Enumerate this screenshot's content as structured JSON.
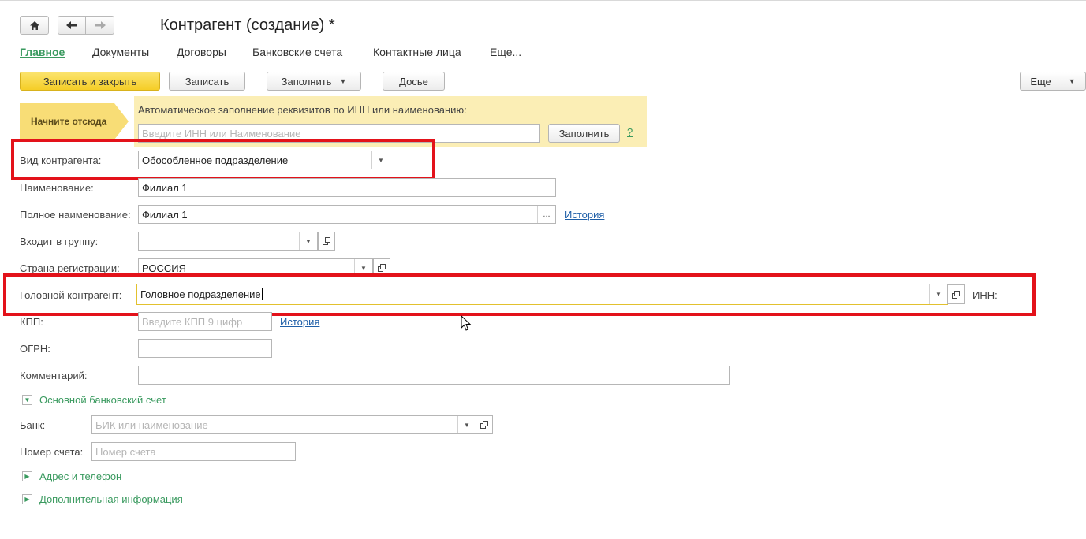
{
  "window": {
    "title": "Контрагент (создание) *"
  },
  "tabs": [
    "Главное",
    "Документы",
    "Договоры",
    "Банковские счета",
    "Контактные лица",
    "Еще..."
  ],
  "toolbar": {
    "save_close": "Записать и закрыть",
    "save": "Записать",
    "fill": "Заполнить",
    "dossier": "Досье",
    "more": "Еще"
  },
  "hint": {
    "start": "Начните отсюда",
    "text": "Автоматическое заполнение реквизитов по ИНН или наименованию:",
    "placeholder": "Введите ИНН или Наименование",
    "fill_button": "Заполнить",
    "help": "?"
  },
  "fields": {
    "kind_label": "Вид контрагента:",
    "kind_value": "Обособленное подразделение",
    "name_label": "Наименование:",
    "name_value": "Филиал 1",
    "fullname_label": "Полное наименование:",
    "fullname_value": "Филиал 1",
    "fullname_dots": "...",
    "history": "История",
    "group_label": "Входит в группу:",
    "group_value": "",
    "country_label": "Страна регистрации:",
    "country_value": "РОССИЯ",
    "head_label": "Головной контрагент:",
    "head_value": "Головное подразделение",
    "inn_label": "ИНН:",
    "kpp_label": "КПП:",
    "kpp_placeholder": "Введите КПП 9 цифр",
    "kpp_history": "История",
    "ogrn_label": "ОГРН:",
    "ogrn_value": "",
    "comment_label": "Комментарий:",
    "comment_value": ""
  },
  "bank_section": {
    "title": "Основной банковский счет",
    "bank_label": "Банк:",
    "bank_placeholder": "БИК или наименование",
    "account_label": "Номер счета:",
    "account_placeholder": "Номер счета"
  },
  "sections": {
    "address": "Адрес и телефон",
    "additional": "Дополнительная информация"
  },
  "colors": {
    "accent_green": "#3a9a5f",
    "highlight_red": "#e3121a",
    "primary_yellow": "#f5ce27",
    "hint_bg": "#fbeeb5"
  },
  "icons": [
    "home-icon",
    "back-arrow-icon",
    "forward-arrow-icon",
    "dropdown-icon",
    "open-icon",
    "expand-icon",
    "collapse-icon",
    "mouse-cursor-icon"
  ]
}
